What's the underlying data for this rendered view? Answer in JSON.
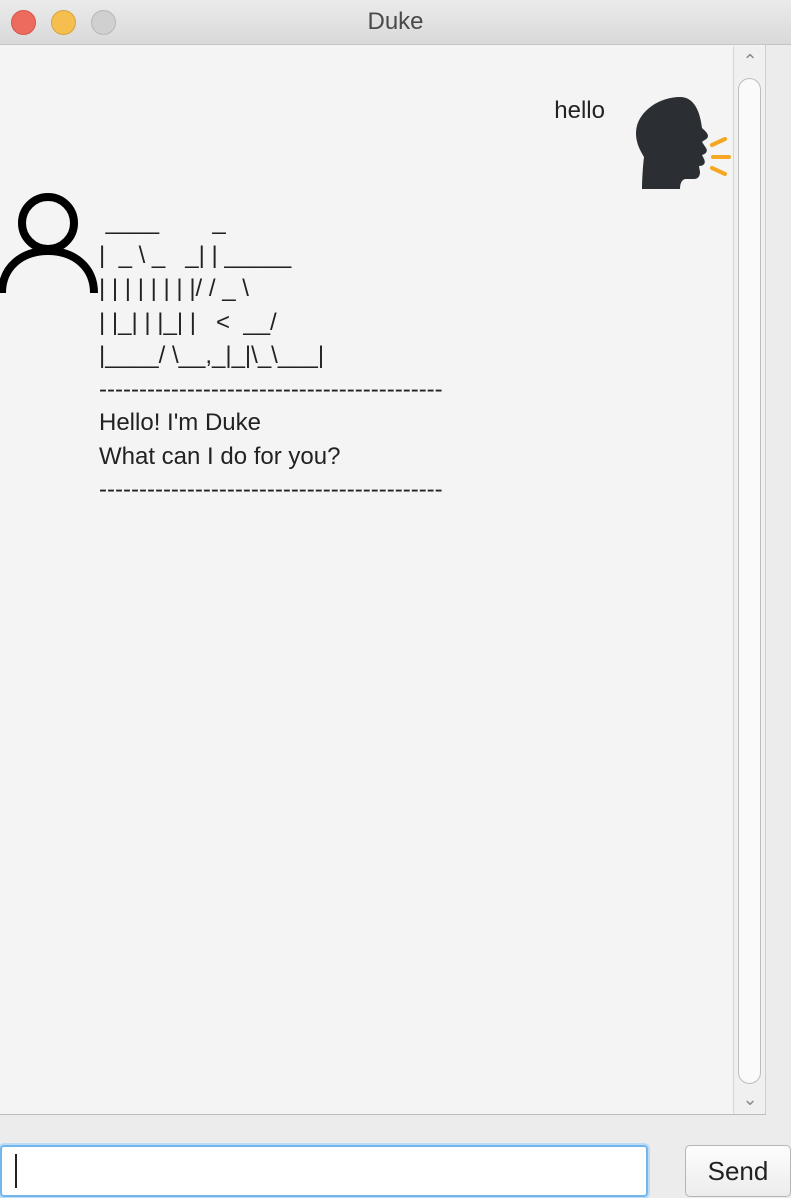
{
  "window": {
    "title": "Duke"
  },
  "conversation": {
    "user_message": "hello",
    "duke_message": " ____        _\n|  _ \\ _   _| | _____\n| | | | | | | |/ / _ \\\n| |_| | |_| |   <  __/\n|____/ \\__,_|_|\\_\\___|\n-------------------------------------------\nHello! I'm Duke\nWhat can I do for you?\n-------------------------------------------"
  },
  "input": {
    "value": "",
    "placeholder": ""
  },
  "send_button": {
    "label": "Send"
  },
  "icons": {
    "user_avatar": "speaking-head-icon",
    "duke_avatar": "person-outline-icon"
  },
  "colors": {
    "close": "#ed6a5e",
    "minimize": "#f5bf4f",
    "zoom": "#d0d0d0",
    "input_focus": "#73b6ee",
    "speech_lines": "#f5a623"
  }
}
